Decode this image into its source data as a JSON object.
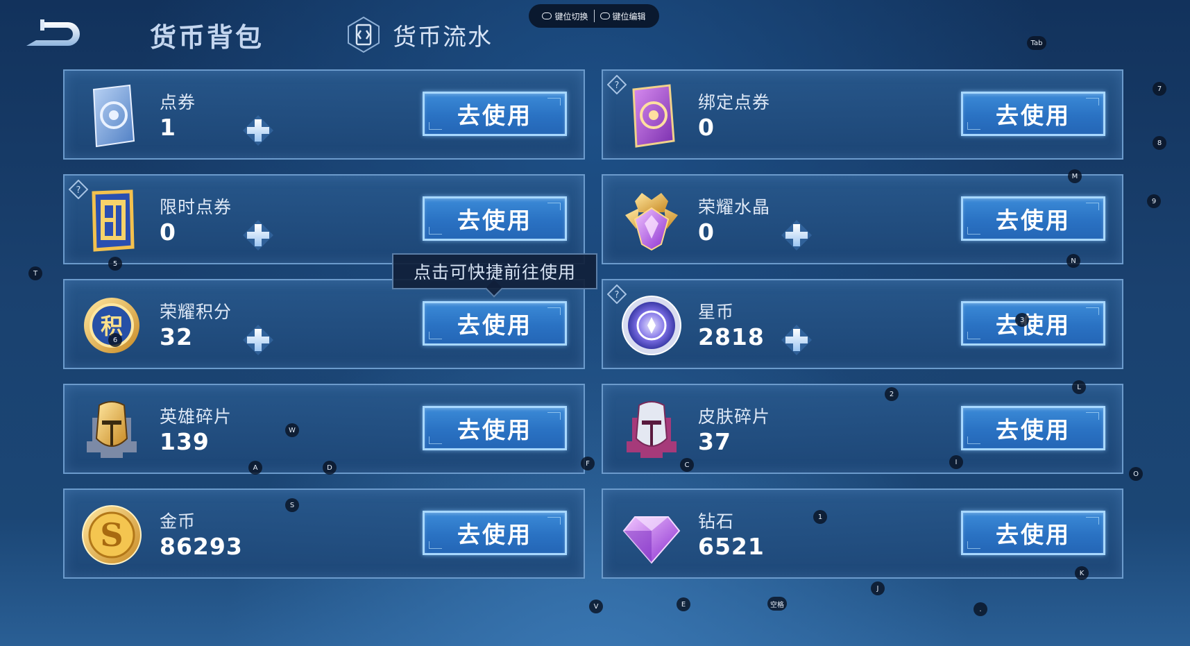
{
  "header": {
    "tab_wallet": "货币背包",
    "tab_flow": "货币流水"
  },
  "keybar": {
    "switch_label": "键位切换",
    "edit_label": "键位编辑"
  },
  "currencies": [
    {
      "id": "voucher",
      "name": "点券",
      "value": "1",
      "button": "去使用",
      "has_plus": true,
      "has_help": false
    },
    {
      "id": "bound-voucher",
      "name": "绑定点券",
      "value": "0",
      "button": "去使用",
      "has_plus": false,
      "has_help": true
    },
    {
      "id": "limited-voucher",
      "name": "限时点券",
      "value": "0",
      "button": "去使用",
      "has_plus": true,
      "has_help": true
    },
    {
      "id": "glory-crystal",
      "name": "荣耀水晶",
      "value": "0",
      "button": "去使用",
      "has_plus": true,
      "has_help": false
    },
    {
      "id": "glory-points",
      "name": "荣耀积分",
      "value": "32",
      "button": "去使用",
      "has_plus": true,
      "has_help": false
    },
    {
      "id": "star-coin",
      "name": "星币",
      "value": "2818",
      "button": "去使用",
      "has_plus": true,
      "has_help": true
    },
    {
      "id": "hero-shards",
      "name": "英雄碎片",
      "value": "139",
      "button": "去使用",
      "has_plus": false,
      "has_help": false
    },
    {
      "id": "skin-shards",
      "name": "皮肤碎片",
      "value": "37",
      "button": "去使用",
      "has_plus": false,
      "has_help": false
    },
    {
      "id": "gold",
      "name": "金币",
      "value": "86293",
      "button": "去使用",
      "has_plus": false,
      "has_help": false
    },
    {
      "id": "diamond",
      "name": "钻石",
      "value": "6521",
      "button": "去使用",
      "has_plus": false,
      "has_help": false
    }
  ],
  "tooltip": "点击可快捷前往使用",
  "key_hints": [
    "Tab",
    "7",
    "8",
    "M",
    "9",
    "T",
    "5",
    "N",
    "6",
    "3",
    "2",
    "L",
    "W",
    "A",
    "D",
    "F",
    "C",
    "I",
    "O",
    "S",
    "1",
    "K",
    "J",
    "V",
    "E",
    "空格",
    "."
  ],
  "icons": {
    "voucher": "blue-card-icon",
    "bound-voucher": "purple-card-icon",
    "limited-voucher": "limited-voucher-icon",
    "glory-crystal": "crystal-icon",
    "glory-points": "points-medal-icon",
    "star-coin": "star-coin-icon",
    "hero-shards": "hero-helmet-icon",
    "skin-shards": "skin-helmet-icon",
    "gold": "gold-coin-icon",
    "diamond": "diamond-icon"
  }
}
